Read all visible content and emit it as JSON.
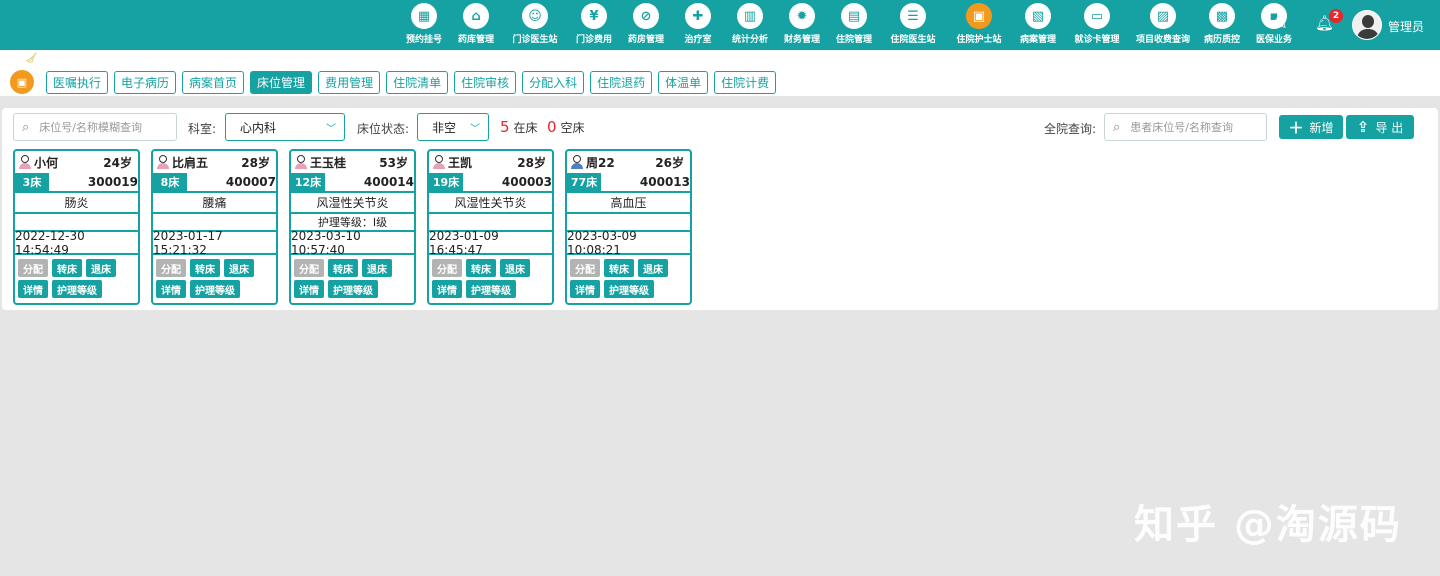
{
  "top_nav": [
    {
      "label": "预约挂号",
      "glyph": "▦",
      "icon": "calendar-icon"
    },
    {
      "label": "药库管理",
      "glyph": "⌂",
      "icon": "warehouse-icon"
    },
    {
      "label": "门诊医生站",
      "glyph": "☺",
      "icon": "doctor-icon"
    },
    {
      "label": "门诊费用",
      "glyph": "¥",
      "icon": "yen-icon"
    },
    {
      "label": "药房管理",
      "glyph": "⊘",
      "icon": "pill-icon"
    },
    {
      "label": "治疗室",
      "glyph": "✚",
      "icon": "treatment-icon"
    },
    {
      "label": "统计分析",
      "glyph": "▥",
      "icon": "chart-icon"
    },
    {
      "label": "财务管理",
      "glyph": "✹",
      "icon": "gear-money-icon"
    },
    {
      "label": "住院管理",
      "glyph": "▤",
      "icon": "bed-icon"
    },
    {
      "label": "住院医生站",
      "glyph": "☰",
      "icon": "inpatient-doctor-icon"
    },
    {
      "label": "住院护士站",
      "glyph": "▣",
      "icon": "nurse-icon",
      "active": true
    },
    {
      "label": "病案管理",
      "glyph": "▧",
      "icon": "record-icon"
    },
    {
      "label": "就诊卡管理",
      "glyph": "▭",
      "icon": "card-icon"
    },
    {
      "label": "项目收费查询",
      "glyph": "▨",
      "icon": "fee-query-icon"
    },
    {
      "label": "病历质控",
      "glyph": "▩",
      "icon": "quality-icon"
    },
    {
      "label": "医保业务",
      "glyph": "▪",
      "icon": "insurance-icon"
    }
  ],
  "header": {
    "notification_count": "2",
    "username": "管理员"
  },
  "tabs": [
    {
      "label": "医嘱执行"
    },
    {
      "label": "电子病历"
    },
    {
      "label": "病案首页"
    },
    {
      "label": "床位管理",
      "active": true
    },
    {
      "label": "费用管理"
    },
    {
      "label": "住院清单"
    },
    {
      "label": "住院审核"
    },
    {
      "label": "分配入科"
    },
    {
      "label": "住院退药"
    },
    {
      "label": "体温单"
    },
    {
      "label": "住院计费"
    }
  ],
  "filters": {
    "bed_search_placeholder": "床位号/名称模糊查询",
    "dept_label": "科室:",
    "dept_value": "心内科",
    "status_label": "床位状态:",
    "status_value": "非空",
    "occupied_count": "5",
    "occupied_label": "在床",
    "empty_count": "0",
    "empty_label": "空床",
    "global_label": "全院查询:",
    "global_placeholder": "患者床位号/名称查询",
    "add_label": "新增",
    "export_label": "导 出"
  },
  "beds": [
    {
      "name": "小何",
      "age": "24岁",
      "gender": "female",
      "bed": "3床",
      "admission_no": "300019",
      "diagnosis": "肠炎",
      "nursing": "",
      "time": "2022-12-30 14:54:49"
    },
    {
      "name": "比肩五",
      "age": "28岁",
      "gender": "female",
      "bed": "8床",
      "admission_no": "400007",
      "diagnosis": "腰痛",
      "nursing": "",
      "time": "2023-01-17 15:21:32"
    },
    {
      "name": "王玉桂",
      "age": "53岁",
      "gender": "female",
      "bed": "12床",
      "admission_no": "400014",
      "diagnosis": "风湿性关节炎",
      "nursing": "护理等级：I级",
      "time": "2023-03-10 10:57:40"
    },
    {
      "name": "王凯",
      "age": "28岁",
      "gender": "female",
      "bed": "19床",
      "admission_no": "400003",
      "diagnosis": "风湿性关节炎",
      "nursing": "",
      "time": "2023-01-09 16:45:47"
    },
    {
      "name": "周22",
      "age": "26岁",
      "gender": "male",
      "bed": "77床",
      "admission_no": "400013",
      "diagnosis": "高血压",
      "nursing": "",
      "time": "2023-03-09 10:08:21"
    }
  ],
  "card_actions": {
    "assign": "分配",
    "transfer": "转床",
    "discharge": "退床",
    "detail": "详情",
    "nursing_level": "护理等级"
  },
  "colors": {
    "primary": "#16a2a2",
    "accent": "#f39a1e",
    "danger": "#e8262b",
    "female": "#e8a0b8",
    "male": "#4a7fc1"
  },
  "watermark": "知乎 @淘源码"
}
